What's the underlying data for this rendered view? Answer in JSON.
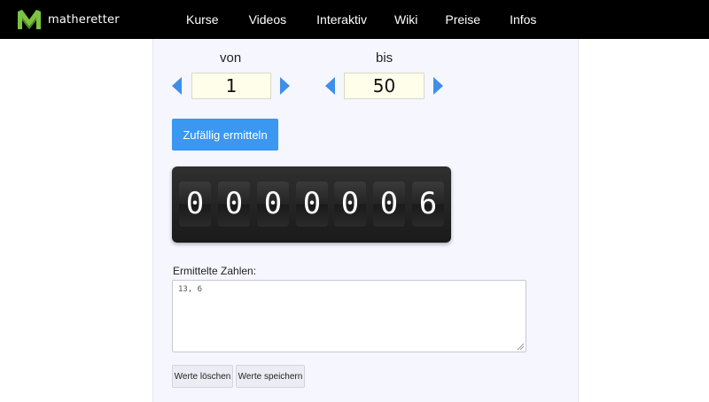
{
  "brand": {
    "name": "matheretter",
    "logo_color": "#7dc242"
  },
  "nav": {
    "items": [
      "Kurse",
      "Videos",
      "Interaktiv",
      "Wiki",
      "Preise",
      "Infos"
    ]
  },
  "range": {
    "from_label": "von",
    "from_value": "1",
    "to_label": "bis",
    "to_value": "50"
  },
  "actions": {
    "random_label": "Zufällig ermitteln"
  },
  "counter": {
    "digits": [
      "0",
      "0",
      "0",
      "0",
      "0",
      "0",
      "6"
    ]
  },
  "results": {
    "label": "Ermittelte Zahlen:",
    "value": "13, 6"
  },
  "buttons": {
    "clear_label": "Werte löschen",
    "save_label": "Werte speichern"
  },
  "colors": {
    "accent": "#3a97f2",
    "arrow": "#3d8fe8",
    "topbar": "#000000"
  }
}
